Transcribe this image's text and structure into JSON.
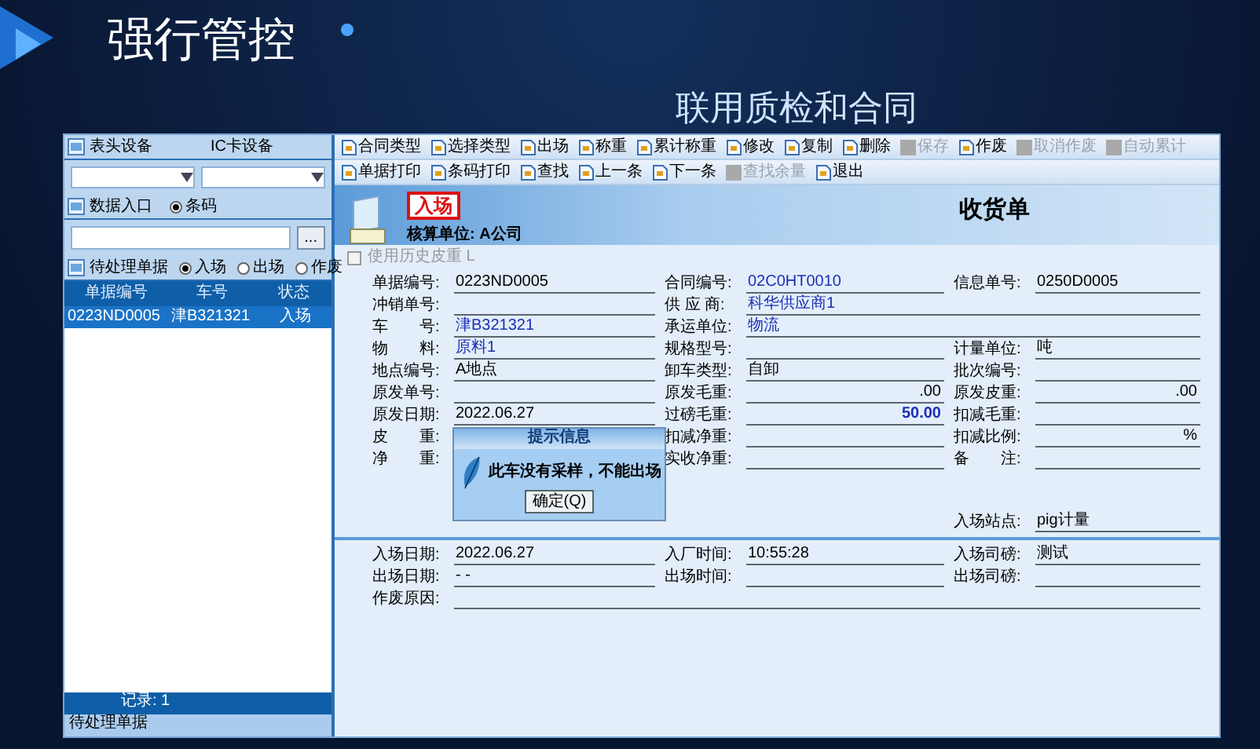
{
  "slide": {
    "title": "强行管控",
    "subtitle": "联用质检和合同"
  },
  "left_panel": {
    "device_labels": [
      "表头设备",
      "IC卡设备"
    ],
    "entry": {
      "label": "数据入口",
      "options": [
        {
          "label": "条码",
          "selected": true
        }
      ]
    },
    "browse_button": "...",
    "pending": {
      "label": "待处理单据",
      "options": [
        {
          "label": "入场",
          "selected": true
        },
        {
          "label": "出场",
          "selected": false
        },
        {
          "label": "作废",
          "selected": false
        }
      ]
    },
    "table": {
      "columns": [
        "单据编号",
        "车号",
        "状态"
      ],
      "rows": [
        {
          "cells": [
            "0223ND0005",
            "津B321321",
            "入场"
          ],
          "selected": true
        }
      ]
    },
    "record_count": "记录: 1",
    "status": "待处理单据"
  },
  "toolbar_rows": [
    [
      {
        "label": "合同类型",
        "disabled": false
      },
      {
        "label": "选择类型",
        "disabled": false
      },
      {
        "label": "出场",
        "disabled": false
      },
      {
        "label": "称重",
        "disabled": false
      },
      {
        "label": "累计称重",
        "disabled": false
      },
      {
        "label": "修改",
        "disabled": false
      },
      {
        "label": "复制",
        "disabled": false
      },
      {
        "label": "删除",
        "disabled": false
      },
      {
        "label": "保存",
        "disabled": true
      },
      {
        "label": "作废",
        "disabled": false
      },
      {
        "label": "取消作废",
        "disabled": true
      },
      {
        "label": "自动累计",
        "disabled": true
      }
    ],
    [
      {
        "label": "单据打印",
        "disabled": false
      },
      {
        "label": "条码打印",
        "disabled": false
      },
      {
        "label": "查找",
        "disabled": false
      },
      {
        "label": "上一条",
        "disabled": false
      },
      {
        "label": "下一条",
        "disabled": false
      },
      {
        "label": "查找余量",
        "disabled": true
      },
      {
        "label": "退出",
        "disabled": false
      }
    ]
  ],
  "header": {
    "stamp": "入场",
    "unit": "核算单位: A公司",
    "title": "收货单"
  },
  "history_tare": {
    "label": "使用历史皮重 L",
    "checked": false,
    "disabled": true
  },
  "form_rows": [
    {
      "kind": "triple",
      "fields": [
        {
          "label": "单据编号:",
          "value": "0223ND0005",
          "kind": "text",
          "bold": false
        },
        {
          "label": "合同编号:",
          "value": "02C0HT0010",
          "kind": "text",
          "bold": false,
          "color": "#1c2fb5"
        },
        {
          "label": "信息单号:",
          "value": "0250D0005",
          "kind": "text",
          "bold": false
        }
      ]
    },
    {
      "kind": "pair",
      "fields": [
        {
          "label": "冲销单号:"
        },
        {
          "label": "供 应 商:",
          "value": "科华供应商1",
          "kind": "text",
          "bold": false,
          "color": "#1c2fb5"
        }
      ]
    },
    {
      "kind": "pair",
      "fields": [
        {
          "label": "车　　号:",
          "value": "津B321321",
          "kind": "text",
          "bold": false,
          "color": "#1c2fb5"
        },
        {
          "label": "承运单位:",
          "value": "物流",
          "kind": "text",
          "bold": false,
          "color": "#1c2fb5"
        }
      ]
    },
    {
      "kind": "triple",
      "fields": [
        {
          "label": "物　　料:",
          "value": "原料1",
          "kind": "text",
          "bold": false,
          "color": "#1c2fb5"
        },
        {
          "label": "规格型号:"
        },
        {
          "label": "计量单位:",
          "value": "吨",
          "kind": "text",
          "bold": false
        }
      ]
    },
    {
      "kind": "triple",
      "fields": [
        {
          "label": "地点编号:",
          "value": "A地点",
          "kind": "text",
          "bold": false
        },
        {
          "label": "卸车类型:",
          "value": "自卸",
          "kind": "text",
          "bold": false
        },
        {
          "label": "批次编号:"
        }
      ]
    },
    {
      "kind": "triple",
      "fields": [
        {
          "label": "原发单号:"
        },
        {
          "label": "原发毛重:",
          "value": ".00",
          "kind": "number",
          "bold": false
        },
        {
          "label": "原发皮重:",
          "value": ".00",
          "kind": "number",
          "bold": false
        }
      ]
    },
    {
      "kind": "triple",
      "fields": [
        {
          "label": "原发日期:",
          "value": "2022.06.27",
          "kind": "text",
          "bold": false
        },
        {
          "label": "过磅毛重:",
          "value": "50.00",
          "kind": "number",
          "bold": true,
          "color": "#1c2fb5"
        },
        {
          "label": "扣减毛重:"
        }
      ]
    },
    {
      "kind": "triple",
      "fields": [
        {
          "label": "皮　　重:"
        },
        {
          "label": "扣减净重:"
        },
        {
          "label": "扣减比例:",
          "value": "%",
          "kind": "number",
          "bold": false
        }
      ]
    },
    {
      "kind": "triple",
      "fields": [
        {
          "label": "净　　重:"
        },
        {
          "label": "实收净重:"
        },
        {
          "label": "备　　注:"
        }
      ]
    },
    {
      "kind": "tail",
      "fields": [
        {
          "label": "入场站点:",
          "value": "pig计量",
          "kind": "text",
          "bold": false
        }
      ]
    }
  ],
  "dialog": {
    "title": "提示信息",
    "message": "此车没有采样，不能出场",
    "button": "确定(Q)"
  },
  "gate_rows": [
    {
      "kind": "triple",
      "fields": [
        {
          "label": "入场日期:",
          "value": "2022.06.27"
        },
        {
          "label": "入厂时间:",
          "value": "10:55:28"
        },
        {
          "label": "入场司磅:",
          "value": "测试"
        }
      ]
    },
    {
      "kind": "triple",
      "fields": [
        {
          "label": "出场日期:",
          "value": "-  -"
        },
        {
          "label": "出场时间:"
        },
        {
          "label": "出场司磅:"
        }
      ]
    },
    {
      "kind": "single",
      "fields": [
        {
          "label": "作废原因:"
        }
      ]
    }
  ]
}
